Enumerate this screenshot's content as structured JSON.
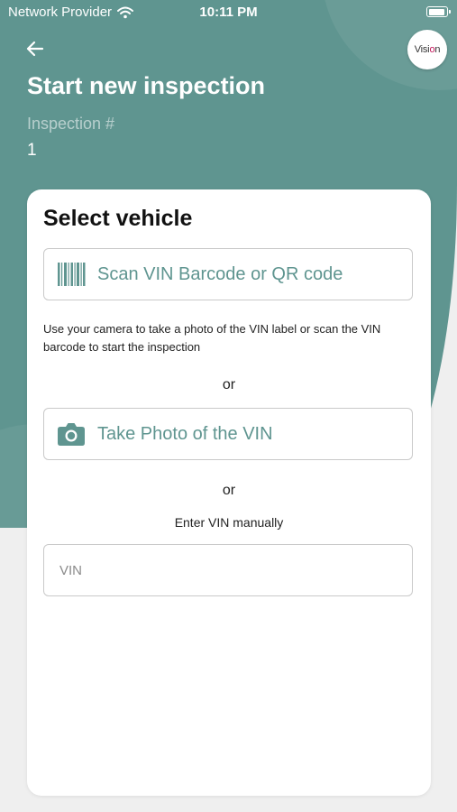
{
  "status_bar": {
    "carrier": "Network Provider",
    "time": "10:11 PM",
    "battery_level": 0.95
  },
  "header": {
    "back_icon": "arrow-left-icon",
    "logo": "Vision",
    "title": "Start new inspection",
    "inspection_label": "Inspection #",
    "inspection_number": "1"
  },
  "card": {
    "title": "Select vehicle",
    "scan_button": {
      "label": "Scan VIN Barcode or QR code",
      "icon": "barcode-icon"
    },
    "help_text": "Use your camera to take a photo of the VIN label or scan the VIN barcode to start the inspection",
    "or_1": "or",
    "photo_button": {
      "label": "Take Photo of the VIN",
      "icon": "camera-icon"
    },
    "or_2": "or",
    "manual_label": "Enter VIN manually",
    "vin_input": {
      "value": "",
      "placeholder": "VIN"
    }
  },
  "colors": {
    "accent": "#5f9590",
    "background": "#efefef",
    "card": "#ffffff",
    "logo_accent": "#c2185b"
  }
}
